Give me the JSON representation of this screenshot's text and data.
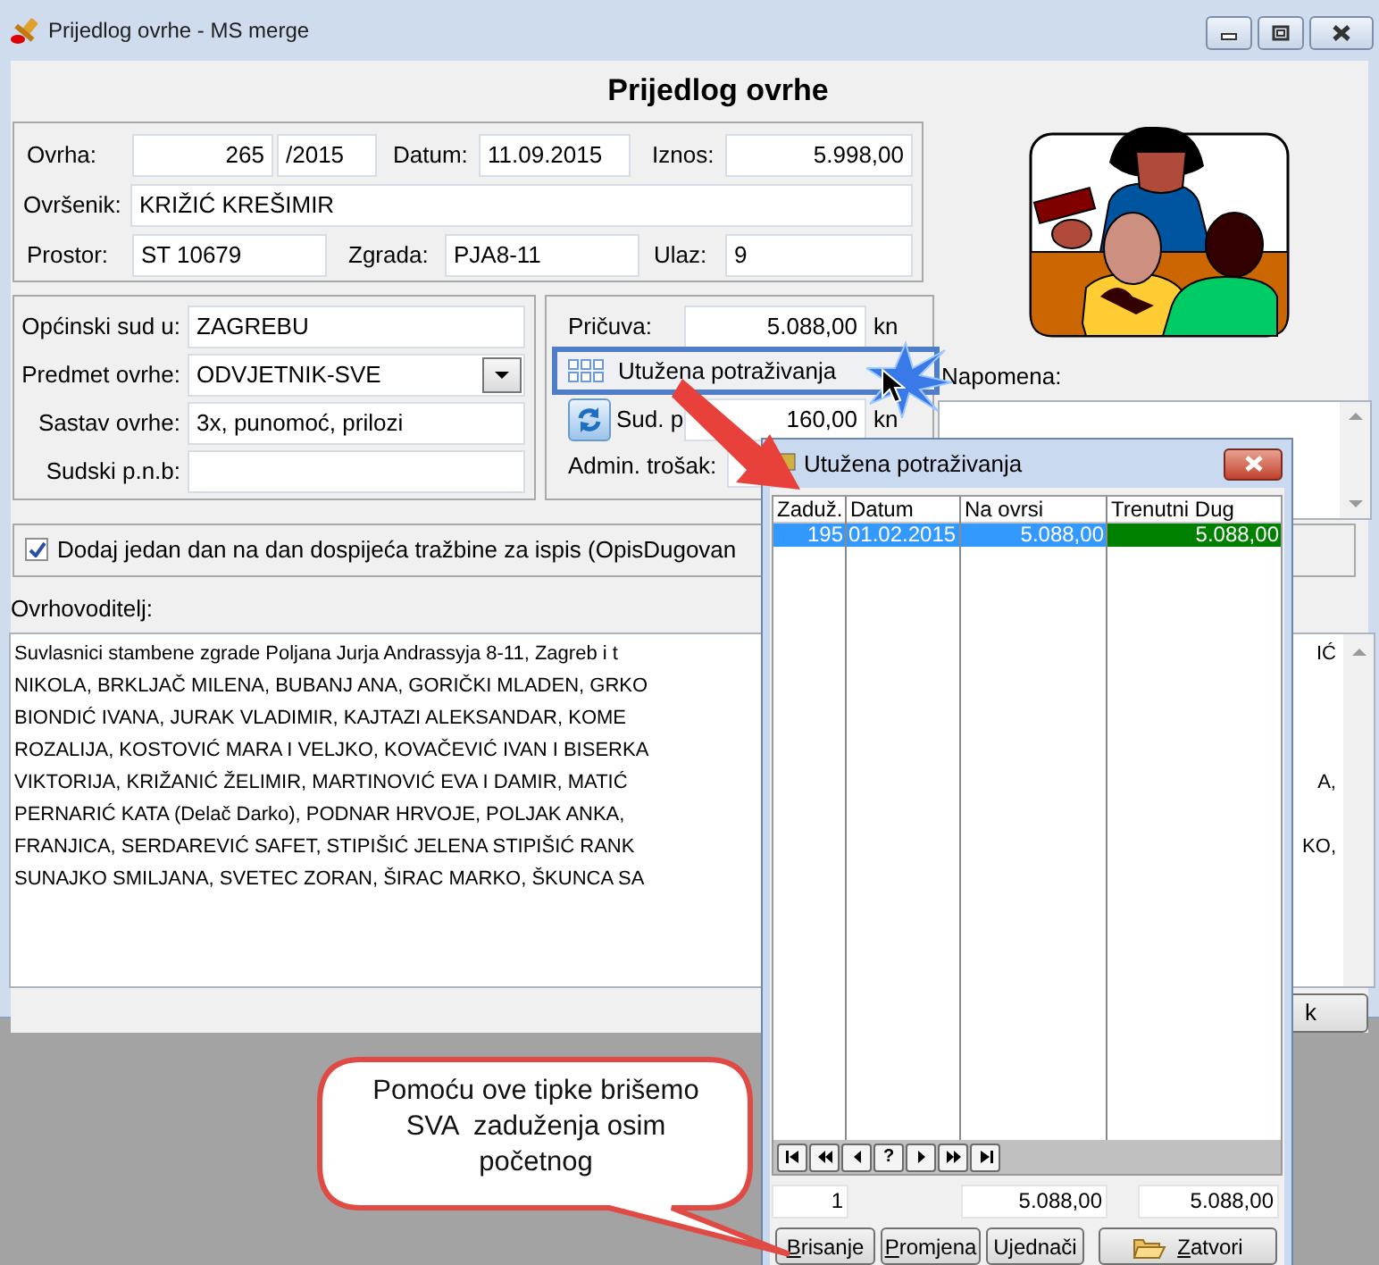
{
  "window": {
    "title": "Prijedlog ovrhe - MS merge"
  },
  "heading": "Prijedlog ovrhe",
  "ovrha": {
    "label": "Ovrha:",
    "number": "265",
    "year": "/2015"
  },
  "datum": {
    "label": "Datum:",
    "value": "11.09.2015"
  },
  "iznos": {
    "label": "Iznos:",
    "value": "5.998,00"
  },
  "ovrsenik": {
    "label": "Ovršenik:",
    "value": "KRIŽIĆ KREŠIMIR"
  },
  "prostor": {
    "label": "Prostor:",
    "value": "ST 10679"
  },
  "zgrada": {
    "label": "Zgrada:",
    "value": "PJA8-11"
  },
  "ulaz": {
    "label": "Ulaz:",
    "value": "9"
  },
  "court": [
    {
      "kind": "text",
      "label": "Općinski sud u:",
      "value": "ZAGREBU"
    },
    {
      "kind": "dropdown",
      "label": "Predmet ovrhe:",
      "value": "ODVJETNIK-SVE"
    },
    {
      "kind": "text",
      "label": "Sastav ovrhe:",
      "value": "3x, punomoć, prilozi"
    },
    {
      "kind": "tinted",
      "label": "Sudski p.n.b:"
    }
  ],
  "pricuva": {
    "label": "Pričuva:",
    "value": "5.088,00",
    "unit": "kn"
  },
  "claims_button": {
    "label": "Utužena potraživanja"
  },
  "sud": {
    "label": "Sud. p",
    "value": "160,00",
    "unit": "kn"
  },
  "admin": {
    "label": "Admin. trošak:"
  },
  "napomena": {
    "label": "Napomena:"
  },
  "checkbox": {
    "label": "Dodaj jedan dan na dan dospijeća tražbine za ispis (OpisDugovan",
    "checked": true
  },
  "ovrhovoditelj": {
    "label": "Ovrhovoditelj:",
    "lines": [
      {
        "left": "Suvlasnici stambene zgrade Poljana Jurja Andrassyja 8-11, Zagreb i t",
        "right": "IĆ"
      },
      {
        "left": "NIKOLA, BRKLJAČ MILENA, BUBANJ ANA, GORIČKI MLADEN, GRKO"
      },
      {
        "left": "BIONDIĆ IVANA, JURAK VLADIMIR, KAJTAZI ALEKSANDAR, KOME"
      },
      {
        "left": "ROZALIJA, KOSTOVIĆ MARA I VELJKO, KOVAČEVIĆ IVAN I BISERKA"
      },
      {
        "left": "VIKTORIJA, KRIŽANIĆ ŽELIMIR, MARTINOVIĆ EVA I DAMIR, MATIĆ",
        "right": "A,"
      },
      {
        "left": "PERNARIĆ KATA (Delač Darko), PODNAR HRVOJE, POLJAK ANKA,"
      },
      {
        "left": "FRANJICA, SERDAREVIĆ SAFET, STIPIŠIĆ JELENA STIPIŠIĆ RANK",
        "right": "KO,"
      },
      {
        "left": "SUNAJKO SMILJANA, SVETEC ZORAN, ŠIRAC MARKO, ŠKUNCA SA"
      }
    ]
  },
  "ok_button": {
    "label": "k"
  },
  "dialog": {
    "title": "Utužena potraživanja",
    "columns": [
      {
        "label": "Zaduž."
      },
      {
        "label": "Datum"
      },
      {
        "label": "Na ovrsi"
      },
      {
        "label": "Trenutni Dug",
        "color": "#008000"
      }
    ],
    "rows": [
      {
        "cells": [
          "195",
          "01.02.2015",
          "5.088,00",
          "5.088,00"
        ],
        "selected": true
      }
    ],
    "nav": [
      {
        "kind": "first"
      },
      {
        "kind": "prev_page"
      },
      {
        "kind": "prev"
      },
      {
        "kind": "help",
        "label": "?"
      },
      {
        "kind": "next"
      },
      {
        "kind": "next_page"
      },
      {
        "kind": "last"
      }
    ],
    "totals": [
      "1",
      "5.088,00",
      "5.088,00"
    ],
    "buttons": [
      {
        "label": "Brisanje",
        "mnemonic": true
      },
      {
        "label": "Promjena",
        "mnemonic": true
      },
      {
        "label": "Ujednači",
        "mnemonic": false
      },
      {
        "label": "Zatvori",
        "mnemonic": true,
        "kind": "with_icon"
      }
    ]
  },
  "callout": {
    "lines": [
      "Pomoću ove tipke brišemo",
      "SVA  zaduženja osim",
      "početnog"
    ]
  }
}
